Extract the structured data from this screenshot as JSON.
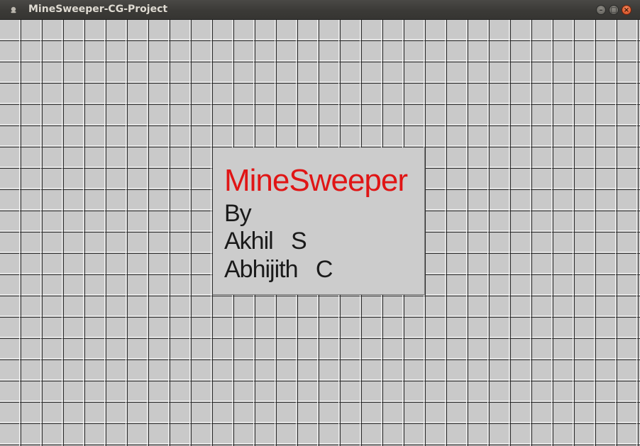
{
  "window": {
    "title": "MineSweeper-CG-Project",
    "controls": {
      "minimize_glyph": "–",
      "maximize_glyph": "□",
      "close_glyph": "×"
    }
  },
  "about": {
    "game_title": "MineSweeper",
    "by": "By",
    "authors": [
      "Akhil   S",
      "Abhijith   C"
    ]
  },
  "colors": {
    "title_color": "#e01515",
    "text_color": "#1a1a1a",
    "cell_fill": "#c9c9c9",
    "grid_dark": "#2e2e2e",
    "grid_light": "#f1f1f1",
    "close_button": "#e0531f"
  }
}
